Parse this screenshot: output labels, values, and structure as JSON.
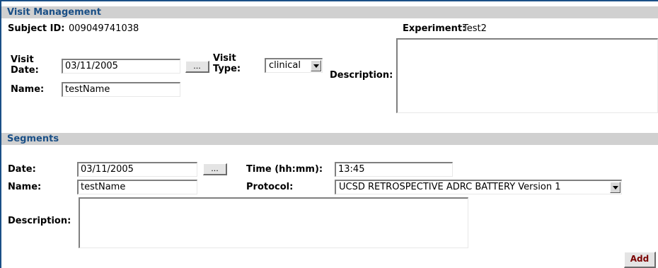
{
  "visit": {
    "header": "Visit Management",
    "subject_id_label": "Subject ID:",
    "subject_id_value": "009049741038",
    "experiment_label": "Experiment:",
    "experiment_value": "Test2",
    "visit_date_label_line1": "Visit",
    "visit_date_label_line2": "Date:",
    "visit_date_value": "03/11/2005",
    "date_picker_label": "...",
    "visit_type_label_line1": "Visit",
    "visit_type_label_line2": "Type:",
    "visit_type_selected": "clinical",
    "description_label": "Description:",
    "description_value": "",
    "name_label": "Name:",
    "name_value": "testName"
  },
  "segments": {
    "header": "Segments",
    "date_label": "Date:",
    "date_value": "03/11/2005",
    "date_picker_label": "...",
    "time_label": "Time (hh:mm):",
    "time_value": "13:45",
    "name_label": "Name:",
    "name_value": "testName",
    "protocol_label": "Protocol:",
    "protocol_selected": "UCSD RETROSPECTIVE ADRC BATTERY Version 1",
    "description_label": "Description:",
    "description_value": "",
    "add_button_label": "Add"
  },
  "colors": {
    "header_text": "#1a4f86",
    "header_bg": "#d0d0d0",
    "add_text": "#7a0000"
  }
}
